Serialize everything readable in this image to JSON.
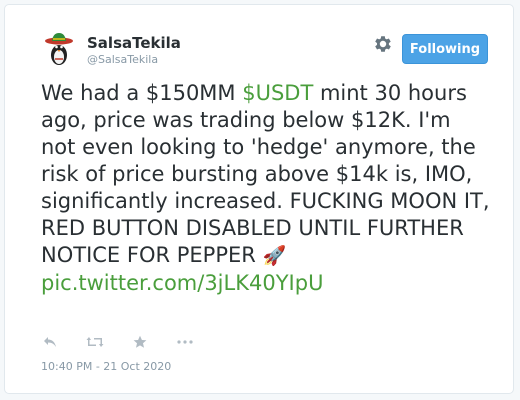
{
  "author": {
    "name": "SalsaTekila",
    "handle": "@SalsaTekila",
    "avatar_icon": "penguin-sombrero-avatar"
  },
  "header": {
    "settings_icon": "gear-icon",
    "follow_button_label": "Following"
  },
  "tweet": {
    "text_before_cashtag": "We had a $150MM ",
    "cashtag": "$USDT",
    "text_after_cashtag": " mint 30 hours ago, price was trading below $12K. I'm not even looking to 'hedge' anymore, the risk of price bursting above $14k is, IMO, significantly increased. FUCKING MOON IT, RED BUTTON DISABLED UNTIL FURTHER NOTICE FOR PEPPER ",
    "emoji": "🚀",
    "link": "pic.twitter.com/3jLK40YIpU"
  },
  "actions": [
    "reply-icon",
    "retweet-icon",
    "favorite-star-icon",
    "more-ellipsis-icon"
  ],
  "timestamp": "10:40 PM - 21 Oct 2020",
  "colors": {
    "link": "#4a9e3c",
    "follow_button": "#4ca3e6",
    "text": "#292f33",
    "muted": "#8899a6"
  }
}
